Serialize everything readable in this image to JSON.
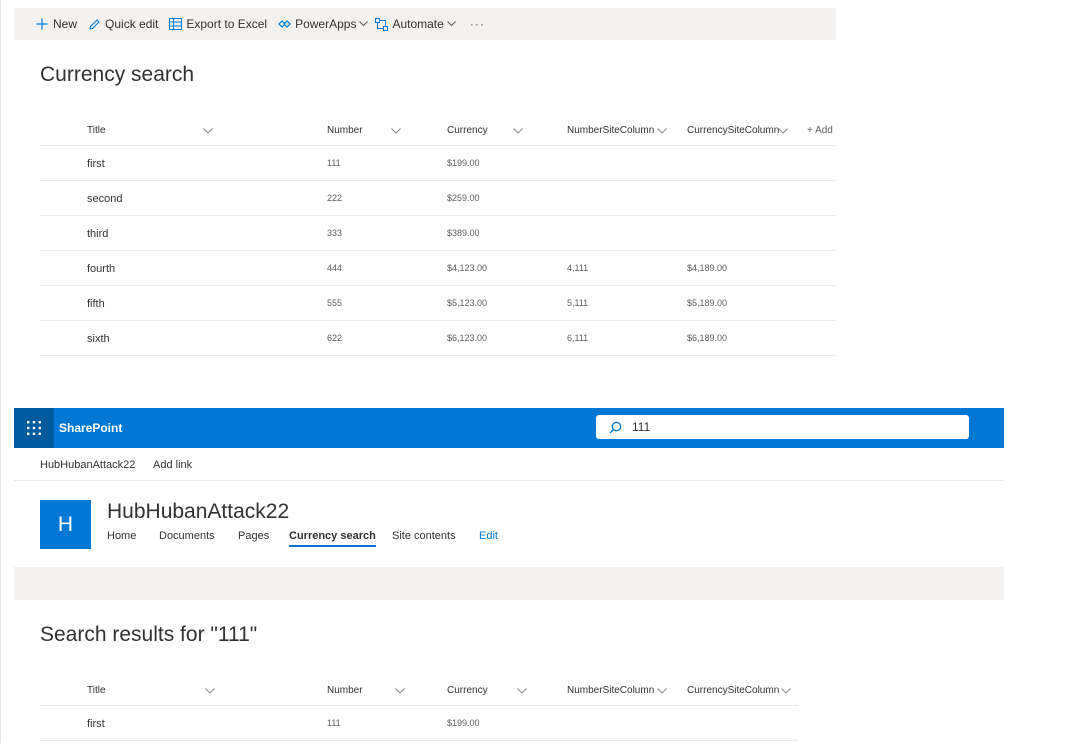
{
  "toolbar": {
    "new_label": "New",
    "quick_edit_label": "Quick edit",
    "export_label": "Export to Excel",
    "powerapps_label": "PowerApps",
    "automate_label": "Automate",
    "more_label": "···"
  },
  "list": {
    "title": "Currency search",
    "columns": [
      "Title",
      "Number",
      "Currency",
      "NumberSiteColumn",
      "CurrencySiteColumn"
    ],
    "add_column_label": "+ Add",
    "rows": [
      {
        "title": "first",
        "number": "111",
        "currency": "$199.00",
        "num_site": "",
        "cur_site": ""
      },
      {
        "title": "second",
        "number": "222",
        "currency": "$259.00",
        "num_site": "",
        "cur_site": ""
      },
      {
        "title": "third",
        "number": "333",
        "currency": "$389.00",
        "num_site": "",
        "cur_site": ""
      },
      {
        "title": "fourth",
        "number": "444",
        "currency": "$4,123.00",
        "num_site": "4,111",
        "cur_site": "$4,189.00"
      },
      {
        "title": "fifth",
        "number": "555",
        "currency": "$5,123.00",
        "num_site": "5,111",
        "cur_site": "$5,189.00"
      },
      {
        "title": "sixth",
        "number": "622",
        "currency": "$6,123.00",
        "num_site": "6,111",
        "cur_site": "$6,189.00"
      }
    ]
  },
  "suite": {
    "brand": "SharePoint",
    "search_value": "111"
  },
  "hub": {
    "name": "HubHubanAttack22",
    "add_link": "Add link"
  },
  "site": {
    "logo_letter": "H",
    "title": "HubHubanAttack22",
    "nav": [
      "Home",
      "Documents",
      "Pages",
      "Currency search",
      "Site contents",
      "Edit"
    ]
  },
  "results": {
    "heading": "Search results for \"111\"",
    "columns": [
      "Title",
      "Number",
      "Currency",
      "NumberSiteColumn",
      "CurrencySiteColumn"
    ],
    "rows": [
      {
        "title": "first",
        "number": "111",
        "currency": "$199.00",
        "num_site": "",
        "cur_site": ""
      }
    ]
  },
  "colors": {
    "brand_blue": "#0078d4",
    "waffle_blue": "#005a9e",
    "bar_grey": "#f3f2f1"
  }
}
